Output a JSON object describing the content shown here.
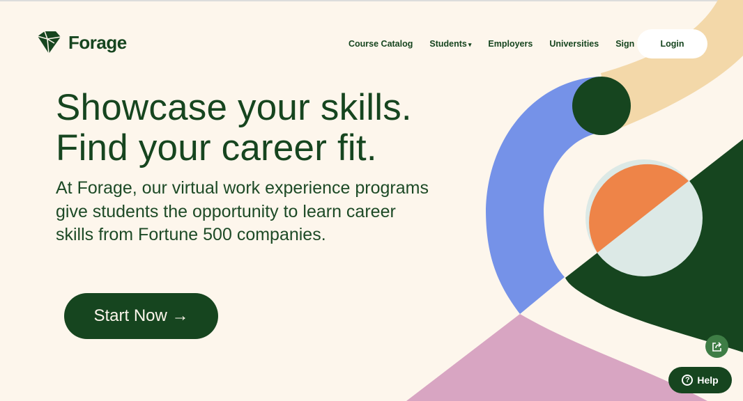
{
  "brand": {
    "name": "Forage",
    "logo_icon": "forage-leaf-icon"
  },
  "nav": {
    "items": [
      {
        "label": "Course Catalog"
      },
      {
        "label": "Students",
        "caret": "▾"
      },
      {
        "label": "Employers"
      },
      {
        "label": "Universities"
      },
      {
        "label": "Sign Up"
      }
    ],
    "login_label": "Login"
  },
  "hero": {
    "headline_line1": "Showcase your skills.",
    "headline_line2": "Find your career fit.",
    "description": "At Forage, our virtual work experience programs give students the opportunity to learn career skills from Fortune 500 companies.",
    "cta_label": "Start Now →"
  },
  "widgets": {
    "share_icon": "share-icon",
    "help_label": "Help",
    "help_icon": "?"
  },
  "colors": {
    "background": "#fdf6ec",
    "brand_green": "#16451f",
    "blue": "#7592e8",
    "peach": "#f3d8a9",
    "orange": "#ee8448",
    "mint": "#dce9e6",
    "pink": "#d8a5c2"
  }
}
